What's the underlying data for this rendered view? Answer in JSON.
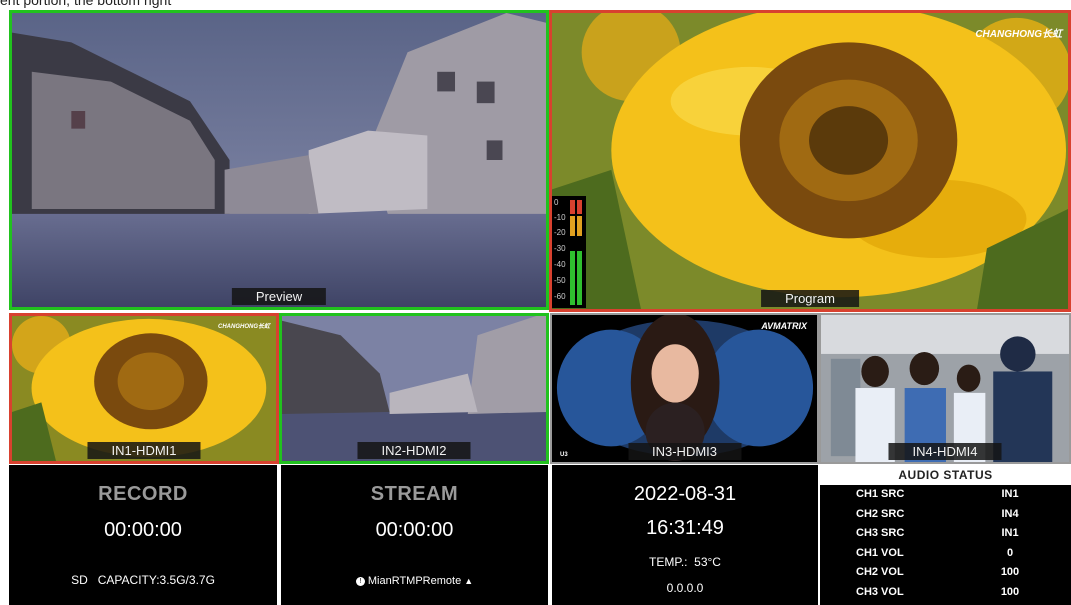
{
  "caption": "ent portion, the bottom right ",
  "preview": {
    "label": "Preview"
  },
  "program": {
    "label": "Program",
    "brand": "CHANGHONG长虹"
  },
  "vu_meter": {
    "ticks": [
      "0",
      "-10",
      "-20",
      "-30",
      "-40",
      "-50",
      "-60"
    ]
  },
  "inputs": [
    {
      "label": "IN1-HDMI1",
      "brand": "CHANGHONG长虹"
    },
    {
      "label": "IN2-HDMI2"
    },
    {
      "label": "IN3-HDMI3",
      "brand": "AVMATRIX",
      "corner": "U3"
    },
    {
      "label": "IN4-HDMI4"
    }
  ],
  "record": {
    "title": "RECORD",
    "time": "00:00:00",
    "capacity": "SD   CAPACITY:3.5G/3.7G"
  },
  "stream": {
    "title": "STREAM",
    "time": "00:00:00",
    "status": "MianRTMPRemote"
  },
  "clock": {
    "date": "2022-08-31",
    "time": "16:31:49",
    "temp": "TEMP.:  53°C",
    "ip": "0.0.0.0"
  },
  "audio_status": {
    "title": "AUDIO STATUS",
    "rows": [
      {
        "key": "CH1 SRC",
        "value": "IN1"
      },
      {
        "key": "CH2 SRC",
        "value": "IN4"
      },
      {
        "key": "CH3 SRC",
        "value": "IN1"
      },
      {
        "key": "CH1 VOL",
        "value": "0"
      },
      {
        "key": "CH2 VOL",
        "value": "100"
      },
      {
        "key": "CH3 VOL",
        "value": "100"
      }
    ]
  },
  "colors": {
    "preview_border": "#21c21e",
    "program_border": "#d8412f",
    "panel_bg": "#000000"
  }
}
